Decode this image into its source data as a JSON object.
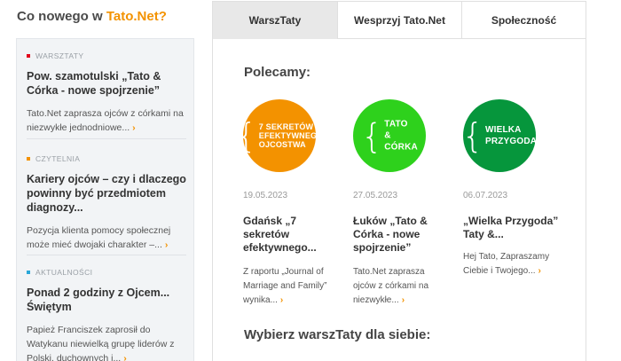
{
  "sidebar": {
    "title_prefix": "Co nowego w ",
    "title_brand": "Tato.Net?",
    "items": [
      {
        "category": "WARSZTATY",
        "category_color": "#e2001a",
        "headline": "Pow. szamotulski „Tato & Córka - nowe spojrzenie”",
        "excerpt": "Tato.Net zaprasza ojców z córkami na niezwykłe jednodniowe...",
        "more": "›"
      },
      {
        "category": "CZYTELNIA",
        "category_color": "#f39200",
        "headline": "Kariery ojców – czy i dlaczego powinny być przedmiotem diagnozy...",
        "excerpt": "Pozycja klienta pomocy społecznej może mieć dwojaki charakter –...",
        "more": "›"
      },
      {
        "category": "AKTUALNOŚCI",
        "category_color": "#2aa7d8",
        "headline": "Ponad 2 godziny z Ojcem... Świętym",
        "excerpt": "Papież Franciszek zaprosił do Watykanu niewielką grupę liderów z Polski, duchownych i...",
        "more": "›"
      }
    ]
  },
  "tabs": [
    {
      "label": "WarszTaty",
      "active": true
    },
    {
      "label": "Wesprzyj Tato.Net",
      "active": false
    },
    {
      "label": "Społeczność",
      "active": false
    }
  ],
  "main": {
    "recommended_title": "Polecamy:",
    "choose_title": "Wybierz warszTaty dla siebie:",
    "cards": [
      {
        "color": "#f39200",
        "logo_text": [
          "7 sekretów",
          "efektywnego",
          "ojcostwa"
        ],
        "date": "19.05.2023",
        "title": "Gdańsk „7 sekretów efektywnego...",
        "excerpt": "Z raportu „Journal of Marriage and Family” wynika...",
        "more": "›"
      },
      {
        "color": "#2ed11c",
        "logo_text": [
          "Tato",
          "& Córka"
        ],
        "date": "27.05.2023",
        "title": "Łuków „Tato & Córka - nowe spojrzenie”",
        "excerpt": "Tato.Net zaprasza ojców z córkami na niezwykłe...",
        "more": "›"
      },
      {
        "color": "#06963c",
        "logo_text": [
          "Wielka",
          "Przygoda"
        ],
        "date": "06.07.2023",
        "title": "„Wielka Przygoda” Taty &...",
        "excerpt": "Hej Tato, Zapraszamy Ciebie i Twojego...",
        "more": "›"
      }
    ]
  }
}
